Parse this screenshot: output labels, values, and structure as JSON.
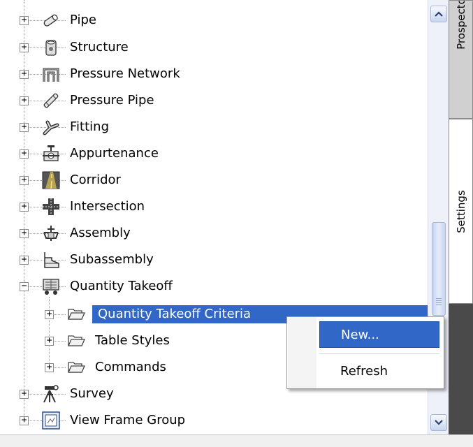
{
  "tree": {
    "items": [
      {
        "label": "Pipe",
        "icon": "pipe-icon"
      },
      {
        "label": "Structure",
        "icon": "structure-icon"
      },
      {
        "label": "Pressure Network",
        "icon": "pressure-network-icon"
      },
      {
        "label": "Pressure Pipe",
        "icon": "pressure-pipe-icon"
      },
      {
        "label": "Fitting",
        "icon": "fitting-icon"
      },
      {
        "label": "Appurtenance",
        "icon": "appurtenance-icon"
      },
      {
        "label": "Corridor",
        "icon": "corridor-icon"
      },
      {
        "label": "Intersection",
        "icon": "intersection-icon"
      },
      {
        "label": "Assembly",
        "icon": "assembly-icon"
      },
      {
        "label": "Subassembly",
        "icon": "subassembly-icon"
      },
      {
        "label": "Quantity Takeoff",
        "icon": "quantity-takeoff-icon",
        "expanded": true
      },
      {
        "label": "Quantity Takeoff Criteria",
        "icon": "folder-icon",
        "selected": true
      },
      {
        "label": "Table Styles",
        "icon": "folder-icon"
      },
      {
        "label": "Commands",
        "icon": "folder-icon"
      },
      {
        "label": "Survey",
        "icon": "survey-icon"
      },
      {
        "label": "View Frame Group",
        "icon": "view-frame-group-icon"
      }
    ]
  },
  "context_menu": {
    "items": [
      {
        "label": "New...",
        "highlighted": true
      },
      {
        "label": "Refresh",
        "highlighted": false
      }
    ]
  },
  "side_tabs": {
    "prospector": "Prospector",
    "settings": "Settings"
  },
  "colors": {
    "selection": "#3168c7",
    "tab_dark": "#4a4a4a"
  }
}
